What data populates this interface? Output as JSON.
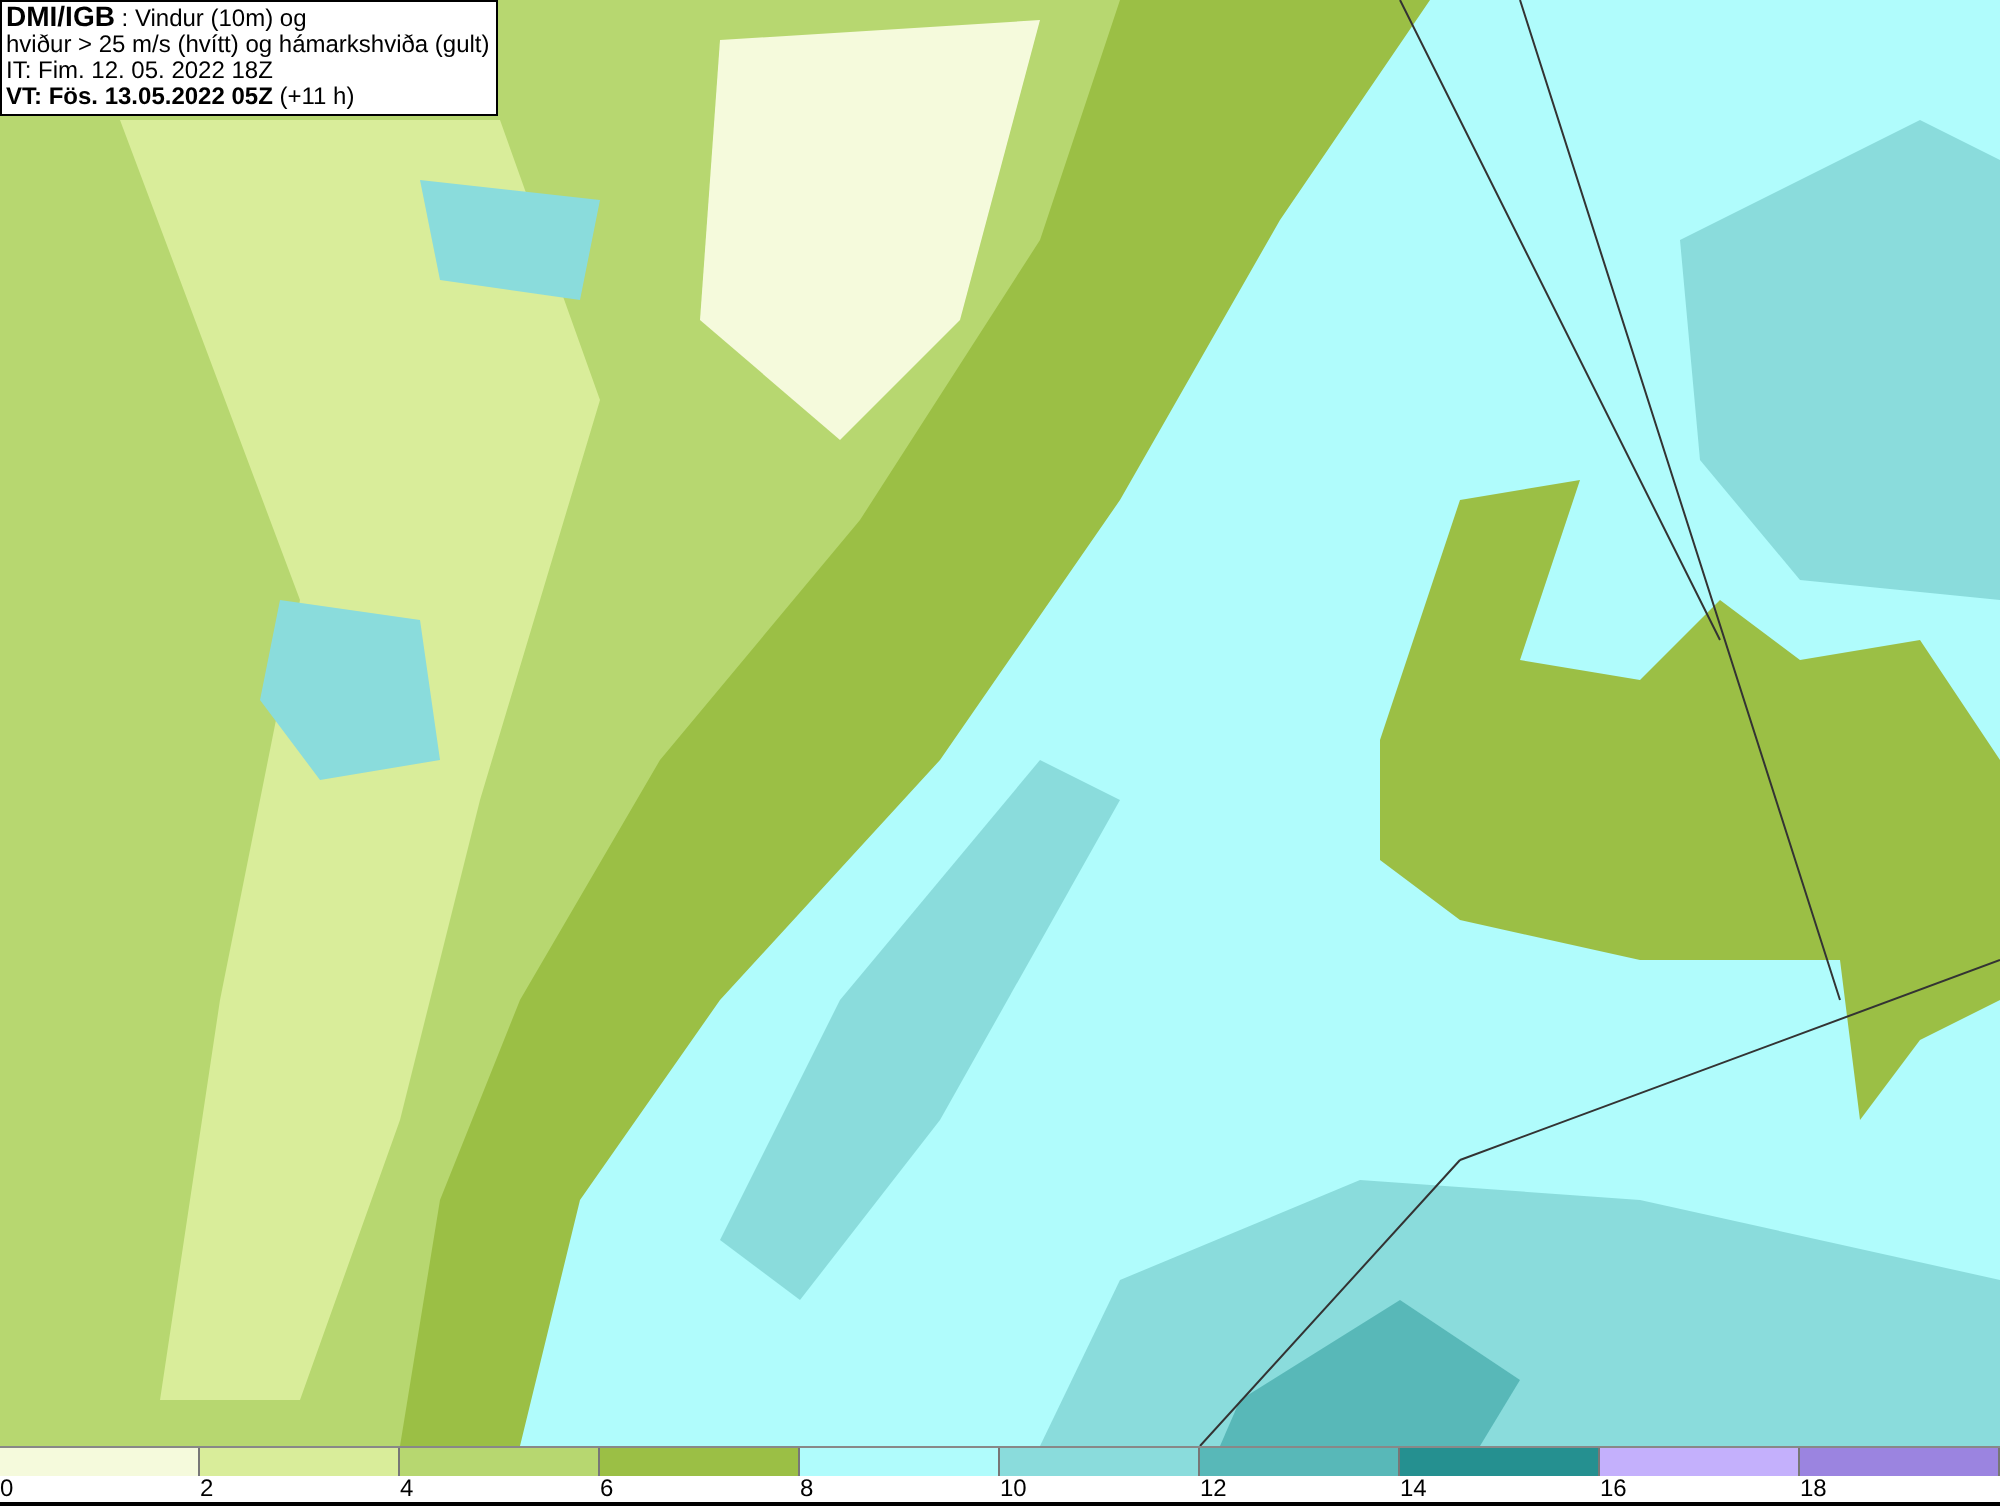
{
  "header": {
    "lines": [
      "**DMI/IGB** : Vindur (10m) og",
      "hviður > 25 m/s (hvítt) og hámarkshviða (gult)",
      "IT: Fim. 12. 05. 2022 18Z",
      "**VT: Fös. 13.05.2022 05Z** (+11 h)"
    ]
  },
  "legend": {
    "bins": [
      {
        "color": "#f5fadc",
        "label": "0"
      },
      {
        "color": "#d9ed9a",
        "label": "2"
      },
      {
        "color": "#b7d770",
        "label": "4"
      },
      {
        "color": "#9bbf45",
        "label": "6"
      },
      {
        "color": "#b0fcfc",
        "label": "8"
      },
      {
        "color": "#8adcdc",
        "label": "10"
      },
      {
        "color": "#58b8b8",
        "label": "12"
      },
      {
        "color": "#259090",
        "label": "14"
      },
      {
        "color": "#c4b0fc",
        "label": "16"
      },
      {
        "color": "#9b84e0",
        "label": "18"
      }
    ]
  }
}
